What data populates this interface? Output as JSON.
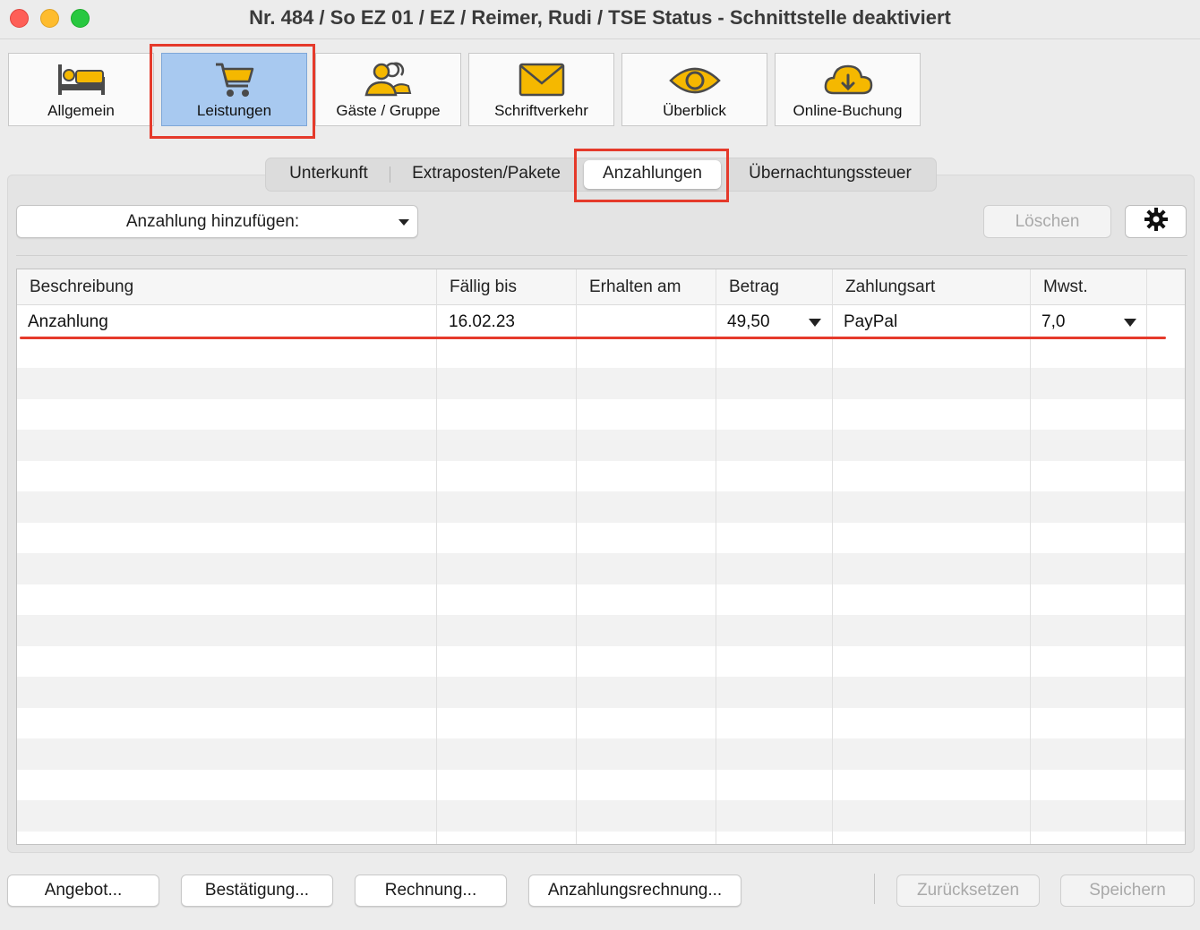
{
  "window": {
    "title": "Nr. 484 / So EZ 01 / EZ / Reimer, Rudi / TSE Status - Schnittstelle deaktiviert"
  },
  "toolbar": {
    "items": [
      {
        "label": "Allgemein",
        "icon": "bed-icon"
      },
      {
        "label": "Leistungen",
        "icon": "cart-icon",
        "active": true
      },
      {
        "label": "Gäste / Gruppe",
        "icon": "people-icon"
      },
      {
        "label": "Schriftverkehr",
        "icon": "envelope-icon"
      },
      {
        "label": "Überblick",
        "icon": "eye-icon"
      },
      {
        "label": "Online-Buchung",
        "icon": "cloud-download-icon"
      }
    ]
  },
  "tabs": {
    "items": [
      {
        "label": "Unterkunft"
      },
      {
        "label": "Extraposten/Pakete"
      },
      {
        "label": "Anzahlungen",
        "active": true
      },
      {
        "label": "Übernachtungssteuer"
      }
    ]
  },
  "controls": {
    "add_dropdown": "Anzahlung hinzufügen:",
    "delete_label": "Löschen",
    "settings_icon": "gear-icon"
  },
  "table": {
    "columns": [
      "Beschreibung",
      "Fällig bis",
      "Erhalten am",
      "Betrag",
      "Zahlungsart",
      "Mwst."
    ],
    "rows": [
      {
        "beschreibung": "Anzahlung",
        "faellig_bis": "16.02.23",
        "erhalten_am": "",
        "betrag": "49,50",
        "zahlungsart": "PayPal",
        "mwst": "7,0"
      }
    ]
  },
  "footer": {
    "angebot": "Angebot...",
    "bestaetigung": "Bestätigung...",
    "rechnung": "Rechnung...",
    "anzahlungsrechnung": "Anzahlungsrechnung...",
    "zuruecksetzen": "Zurücksetzen",
    "speichern": "Speichern"
  },
  "colors": {
    "accent_active": "#a8c9f0",
    "highlight_red": "#e53a2b",
    "icon_yellow": "#f5b800"
  }
}
